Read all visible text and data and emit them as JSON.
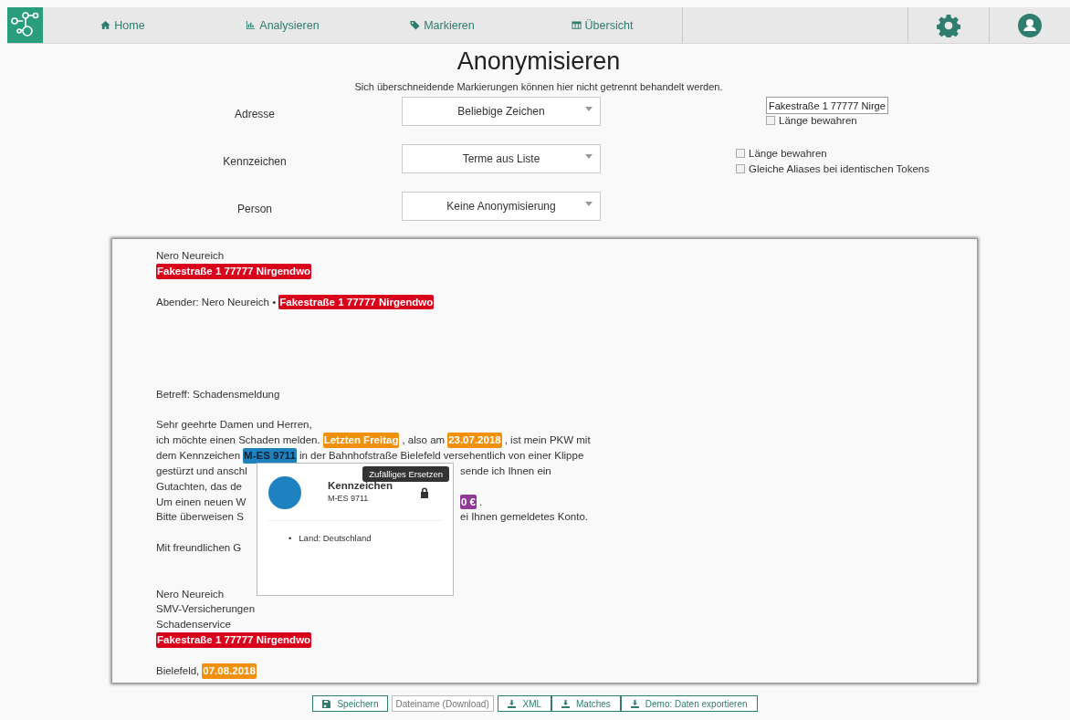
{
  "nav": {
    "items": [
      {
        "label": "Home"
      },
      {
        "label": "Analysieren"
      },
      {
        "label": "Markieren"
      },
      {
        "label": "Übersicht"
      }
    ]
  },
  "title": "Anonymisieren",
  "subtitle": "Sich überschneidende Markierungen können hier nicht getrennt behandelt werden.",
  "rules": [
    {
      "label": "Adresse",
      "method": "Beliebige Zeichen",
      "options": [
        {
          "kind": "input",
          "value": "Fakestraße 1 77777 Nirge"
        },
        {
          "kind": "checkbox",
          "label": "Länge bewahren",
          "checked": false
        }
      ]
    },
    {
      "label": "Kennzeichen",
      "method": "Terme aus Liste",
      "options": [
        {
          "kind": "checkbox",
          "label": "Länge bewahren",
          "checked": false
        },
        {
          "kind": "checkbox",
          "label": "Gleiche Aliases bei identischen Tokens",
          "checked": false
        }
      ]
    },
    {
      "label": "Person",
      "method": "Keine Anonymisierung"
    }
  ],
  "document": {
    "lines": [
      {
        "kind": "text",
        "segments": [
          {
            "text": "Nero Neureich"
          }
        ]
      },
      {
        "kind": "text",
        "segments": [
          {
            "text": "Fakestraße 1 77777 Nirgendwo",
            "color": "#d9001b",
            "selected": false
          }
        ]
      },
      {
        "kind": "blank"
      },
      {
        "kind": "text",
        "segments": [
          {
            "text": "Abender: Nero Neureich •"
          },
          {
            "text": "Fakestraße 1 77777 Nirgendwo",
            "color": "#d9001b",
            "selected": false
          }
        ]
      },
      {
        "kind": "blank"
      },
      {
        "kind": "blank"
      },
      {
        "kind": "blank"
      },
      {
        "kind": "blank"
      },
      {
        "kind": "blank"
      },
      {
        "kind": "text",
        "segments": [
          {
            "text": "Betreff: Schadensmeldung"
          }
        ]
      },
      {
        "kind": "blank"
      },
      {
        "kind": "text",
        "segments": [
          {
            "text": "Sehr geehrte Damen und Herren,"
          }
        ]
      },
      {
        "kind": "text",
        "segments": [
          {
            "text": "ich möchte einen Schaden melden."
          },
          {
            "text": "Letzten Freitag",
            "color": "#f0900b",
            "selected": false
          },
          {
            "text": ", also am"
          },
          {
            "text": "23.07.2018",
            "color": "#f0900b",
            "selected": false
          },
          {
            "text": ", ist mein PKW mit"
          }
        ]
      },
      {
        "kind": "text",
        "segments": [
          {
            "text": "dem Kennzeichen"
          },
          {
            "text": "M-ES 9711",
            "color": "#1f82c0",
            "selected": true
          },
          {
            "text": "in der Bahnhofstraße Bielefeld versehentlich von einer Klippe"
          }
        ]
      },
      {
        "kind": "split",
        "left": [
          {
            "text": "gestürzt und anschl"
          }
        ],
        "right": [
          {
            "text": "sende ich Ihnen ein"
          }
        ]
      },
      {
        "kind": "split",
        "left": [
          {
            "text": "Gutachten, das de"
          }
        ]
      },
      {
        "kind": "split",
        "left": [
          {
            "text": "Um einen neuen W"
          }
        ],
        "right": [
          {
            "text": "0 €",
            "color": "#8e3a96",
            "selected": false
          },
          {
            "text": "."
          }
        ]
      },
      {
        "kind": "split",
        "left": [
          {
            "text": "Bitte überweisen S"
          }
        ],
        "right": [
          {
            "text": "ei Ihnen gemeldetes Konto."
          }
        ]
      },
      {
        "kind": "split"
      },
      {
        "kind": "split",
        "left": [
          {
            "text": "Mit freundlichen G"
          }
        ]
      },
      {
        "kind": "blank"
      },
      {
        "kind": "blank"
      },
      {
        "kind": "text",
        "segments": [
          {
            "text": "Nero Neureich"
          }
        ]
      },
      {
        "kind": "text",
        "segments": [
          {
            "text": "SMV-Versicherungen"
          }
        ]
      },
      {
        "kind": "text",
        "segments": [
          {
            "text": "Schadenservice"
          }
        ]
      },
      {
        "kind": "text",
        "segments": [
          {
            "text": "Fakestraße 1 77777 Nirgendwo",
            "color": "#d9001b",
            "selected": false
          }
        ]
      },
      {
        "kind": "blank"
      },
      {
        "kind": "text",
        "segments": [
          {
            "text": "Bielefeld,"
          },
          {
            "text": "07.08.2018",
            "color": "#f0900b",
            "selected": false
          }
        ]
      }
    ],
    "popup": {
      "title": "Kennzeichen",
      "value": "M-ES 9711",
      "color": "#1f82c0",
      "tooltip": "Zufälliges Ersetzen",
      "details": [
        {
          "bullet": "•",
          "text": "Land: Deutschland"
        }
      ]
    }
  },
  "toolbar": [
    {
      "kind": "button",
      "label": "Speichern"
    },
    {
      "kind": "input",
      "placeholder": "Dateiname (Download)"
    },
    {
      "kind": "button",
      "label": "XML"
    },
    {
      "kind": "button",
      "label": "Matches"
    },
    {
      "kind": "button",
      "label": "Demo: Daten exportieren"
    }
  ]
}
